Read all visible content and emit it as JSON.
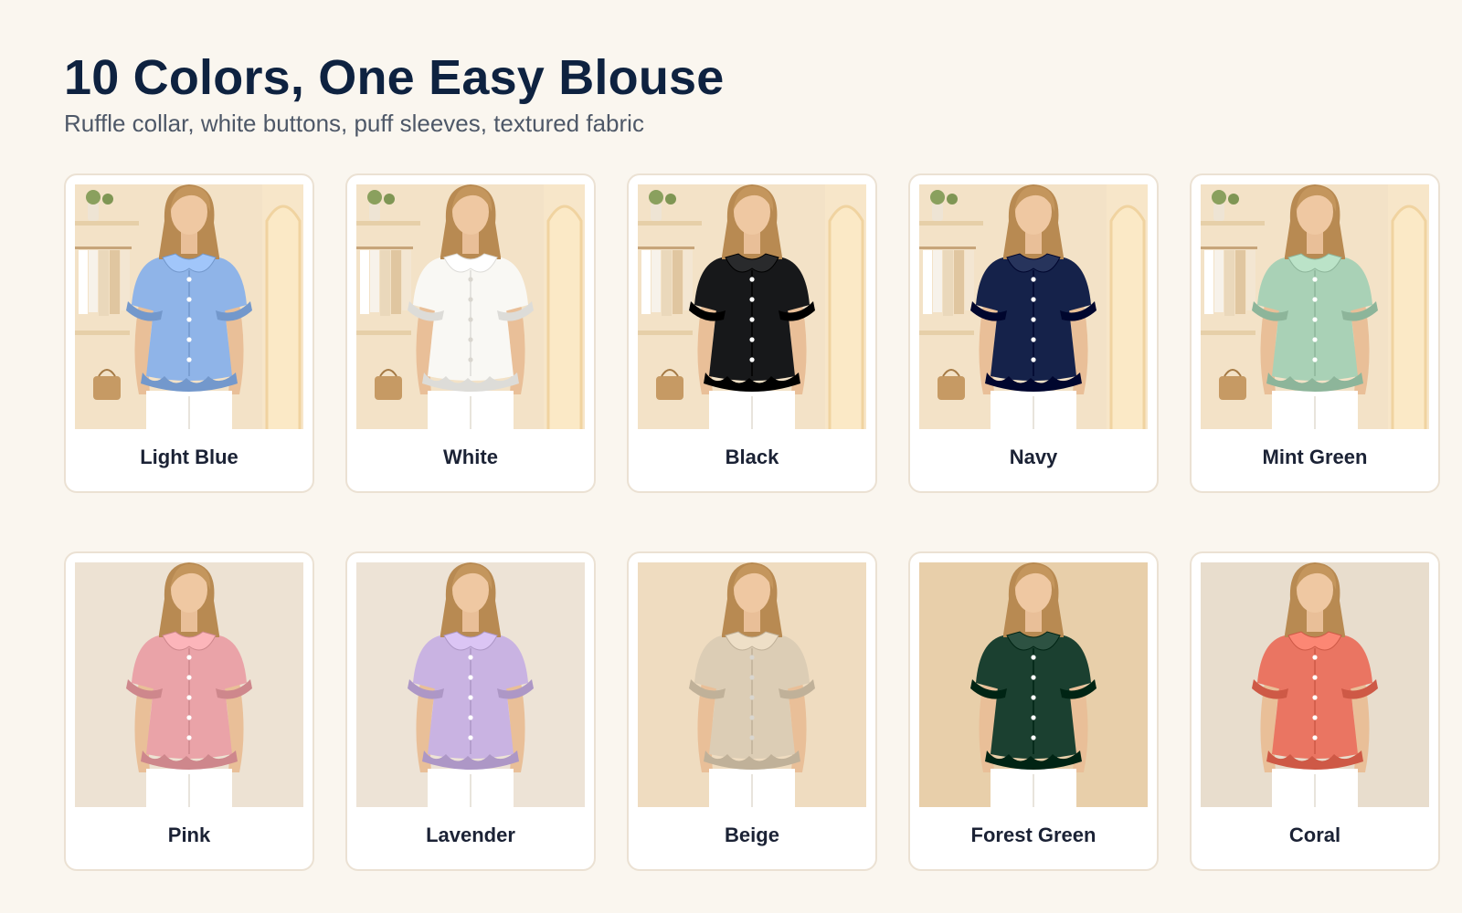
{
  "header": {
    "title": "10 Colors, One Easy Blouse",
    "subtitle": "Ruffle collar, white buttons, puff sleeves, textured fabric"
  },
  "colors": [
    {
      "label": "Light Blue",
      "shirt": "#8fb4e8",
      "bg": "#f3e2c7",
      "scene": "boutique"
    },
    {
      "label": "White",
      "shirt": "#f9f8f4",
      "bg": "#f3e2c7",
      "scene": "boutique"
    },
    {
      "label": "Black",
      "shirt": "#17181a",
      "bg": "#f3e2c7",
      "scene": "boutique"
    },
    {
      "label": "Navy",
      "shirt": "#15224a",
      "bg": "#f3e2c7",
      "scene": "boutique"
    },
    {
      "label": "Mint Green",
      "shirt": "#a9d1b6",
      "bg": "#f3e2c7",
      "scene": "boutique"
    },
    {
      "label": "Pink",
      "shirt": "#eaa3a8",
      "bg": "#ede2d3",
      "scene": "studio"
    },
    {
      "label": "Lavender",
      "shirt": "#c9b3e2",
      "bg": "#ede3d6",
      "scene": "studio"
    },
    {
      "label": "Beige",
      "shirt": "#dccdb5",
      "bg": "#efdcc0",
      "scene": "studio"
    },
    {
      "label": "Forest Green",
      "shirt": "#1b4030",
      "bg": "#e8cfaa",
      "scene": "studio"
    },
    {
      "label": "Coral",
      "shirt": "#ea7562",
      "bg": "#e8ddcd",
      "scene": "studio"
    }
  ]
}
